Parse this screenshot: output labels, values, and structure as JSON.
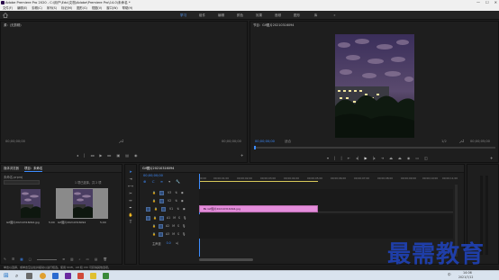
{
  "window": {
    "title": "Adobe Premiere Pro 2020 - C:\\用户\\Edu\\文档\\Adobe\\Premiere Pro\\14.0\\未命名 *",
    "controls": [
      "—",
      "☐",
      "✕"
    ]
  },
  "menu": [
    "文件(F)",
    "编辑(E)",
    "剪辑(C)",
    "序列(S)",
    "标记(M)",
    "图形(G)",
    "视图(V)",
    "窗口(W)",
    "帮助(H)"
  ],
  "workspaces": {
    "tabs": [
      "学习",
      "组件",
      "编辑",
      "颜色",
      "效果",
      "音频",
      "图形",
      "库"
    ],
    "active": 0,
    "more": "»"
  },
  "source_panel": {
    "title": "源：(无剪辑)",
    "timecode_left": "00;00;00;00",
    "timecode_right": "00;00;00;00"
  },
  "program_panel": {
    "title": "节目：Gif图片20210316094",
    "timecode": "00;00;00;00",
    "fit": "适合",
    "fraction": "1/2",
    "duration": "00;00;05;00"
  },
  "project_panel": {
    "tabs": [
      "媒体浏览器",
      "项目：未命名"
    ],
    "path": "未命名.prproj",
    "count": "1 项已选择，共 2 项",
    "items": [
      {
        "name": "Gif图片20210316094.jpg",
        "duration": "5;00"
      },
      {
        "name": "Gif图片20210316094",
        "duration": "5;00"
      }
    ]
  },
  "timeline": {
    "tab": "Gif图片20210316094",
    "timecode": "00;00;00;00",
    "ruler": [
      "00;00",
      "00;00;01;00",
      "00;00;02;00",
      "00;00;03;00",
      "00;00;04;00",
      "00;00;05;00",
      "00;00;06;00",
      "00;00;07;00",
      "00;00;08;00",
      "00;00;09;00",
      "00;00;10;00",
      "00;00;11;00",
      "00;00;12;00"
    ],
    "video_tracks": [
      "V3",
      "V2",
      "V1"
    ],
    "audio_tracks": [
      "A1",
      "A2",
      "A3"
    ],
    "master": "主声道",
    "master_value": "0.0",
    "clip_label": "Gif图片20210316094.jpg",
    "clip_color": "#e48ddb"
  },
  "status_bar": "单击以选择，或单击空白处并拖动以进行框选。使用 Shift、Alt 和 Ctrl 可获得其他选项。",
  "watermark": "最需教育",
  "taskbar": {
    "time": "14:06",
    "date": "2021/7/12",
    "lang": "中"
  },
  "colors": {
    "accent": "#3d8cff",
    "clip": "#e48ddb",
    "panel_bg": "#1e1e1e"
  }
}
